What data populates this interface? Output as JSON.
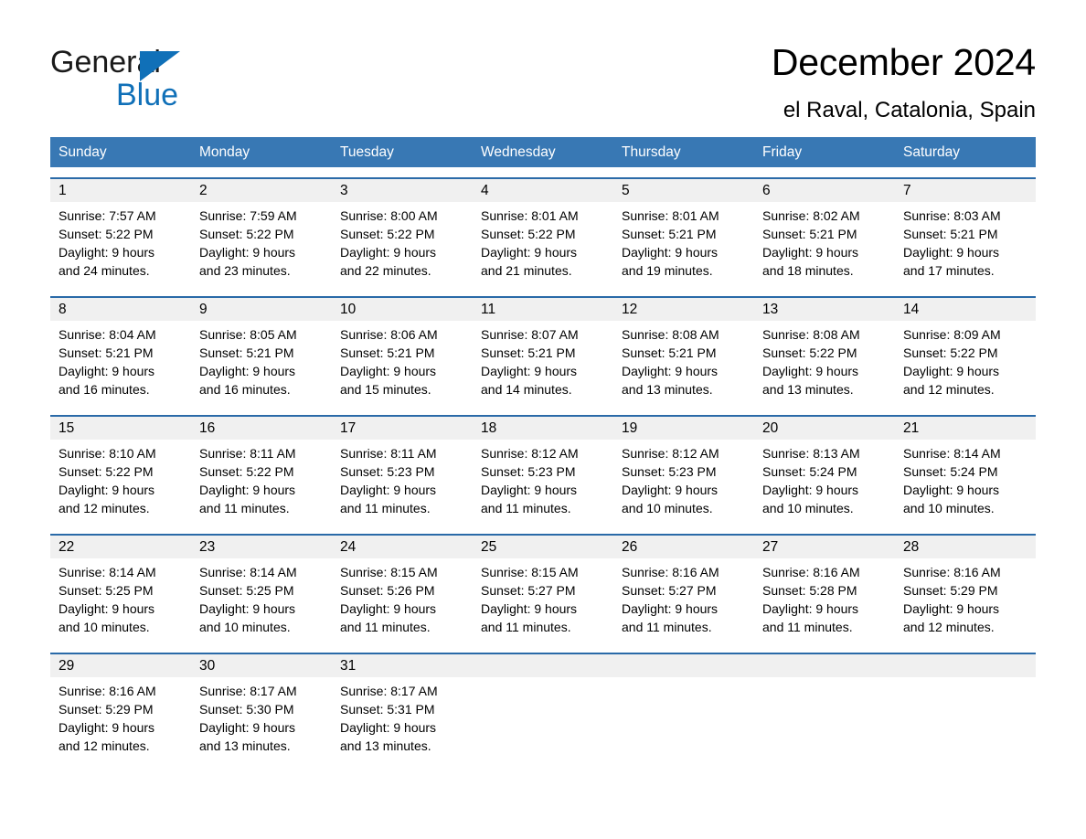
{
  "brand": {
    "name_part1": "General",
    "name_part2": "Blue",
    "triangle_color": "#1070b8"
  },
  "header": {
    "title": "December 2024",
    "subtitle": "el Raval, Catalonia, Spain"
  },
  "colors": {
    "header_blue": "#3878b4",
    "row_divider_blue": "#2a6aa8",
    "daynum_band_gray": "#f0f0f0",
    "brand_blue": "#1070b8"
  },
  "weekdays": [
    "Sunday",
    "Monday",
    "Tuesday",
    "Wednesday",
    "Thursday",
    "Friday",
    "Saturday"
  ],
  "weeks": [
    {
      "days": [
        {
          "num": "1",
          "detail": "Sunrise: 7:57 AM\nSunset: 5:22 PM\nDaylight: 9 hours\nand 24 minutes."
        },
        {
          "num": "2",
          "detail": "Sunrise: 7:59 AM\nSunset: 5:22 PM\nDaylight: 9 hours\nand 23 minutes."
        },
        {
          "num": "3",
          "detail": "Sunrise: 8:00 AM\nSunset: 5:22 PM\nDaylight: 9 hours\nand 22 minutes."
        },
        {
          "num": "4",
          "detail": "Sunrise: 8:01 AM\nSunset: 5:22 PM\nDaylight: 9 hours\nand 21 minutes."
        },
        {
          "num": "5",
          "detail": "Sunrise: 8:01 AM\nSunset: 5:21 PM\nDaylight: 9 hours\nand 19 minutes."
        },
        {
          "num": "6",
          "detail": "Sunrise: 8:02 AM\nSunset: 5:21 PM\nDaylight: 9 hours\nand 18 minutes."
        },
        {
          "num": "7",
          "detail": "Sunrise: 8:03 AM\nSunset: 5:21 PM\nDaylight: 9 hours\nand 17 minutes."
        }
      ]
    },
    {
      "days": [
        {
          "num": "8",
          "detail": "Sunrise: 8:04 AM\nSunset: 5:21 PM\nDaylight: 9 hours\nand 16 minutes."
        },
        {
          "num": "9",
          "detail": "Sunrise: 8:05 AM\nSunset: 5:21 PM\nDaylight: 9 hours\nand 16 minutes."
        },
        {
          "num": "10",
          "detail": "Sunrise: 8:06 AM\nSunset: 5:21 PM\nDaylight: 9 hours\nand 15 minutes."
        },
        {
          "num": "11",
          "detail": "Sunrise: 8:07 AM\nSunset: 5:21 PM\nDaylight: 9 hours\nand 14 minutes."
        },
        {
          "num": "12",
          "detail": "Sunrise: 8:08 AM\nSunset: 5:21 PM\nDaylight: 9 hours\nand 13 minutes."
        },
        {
          "num": "13",
          "detail": "Sunrise: 8:08 AM\nSunset: 5:22 PM\nDaylight: 9 hours\nand 13 minutes."
        },
        {
          "num": "14",
          "detail": "Sunrise: 8:09 AM\nSunset: 5:22 PM\nDaylight: 9 hours\nand 12 minutes."
        }
      ]
    },
    {
      "days": [
        {
          "num": "15",
          "detail": "Sunrise: 8:10 AM\nSunset: 5:22 PM\nDaylight: 9 hours\nand 12 minutes."
        },
        {
          "num": "16",
          "detail": "Sunrise: 8:11 AM\nSunset: 5:22 PM\nDaylight: 9 hours\nand 11 minutes."
        },
        {
          "num": "17",
          "detail": "Sunrise: 8:11 AM\nSunset: 5:23 PM\nDaylight: 9 hours\nand 11 minutes."
        },
        {
          "num": "18",
          "detail": "Sunrise: 8:12 AM\nSunset: 5:23 PM\nDaylight: 9 hours\nand 11 minutes."
        },
        {
          "num": "19",
          "detail": "Sunrise: 8:12 AM\nSunset: 5:23 PM\nDaylight: 9 hours\nand 10 minutes."
        },
        {
          "num": "20",
          "detail": "Sunrise: 8:13 AM\nSunset: 5:24 PM\nDaylight: 9 hours\nand 10 minutes."
        },
        {
          "num": "21",
          "detail": "Sunrise: 8:14 AM\nSunset: 5:24 PM\nDaylight: 9 hours\nand 10 minutes."
        }
      ]
    },
    {
      "days": [
        {
          "num": "22",
          "detail": "Sunrise: 8:14 AM\nSunset: 5:25 PM\nDaylight: 9 hours\nand 10 minutes."
        },
        {
          "num": "23",
          "detail": "Sunrise: 8:14 AM\nSunset: 5:25 PM\nDaylight: 9 hours\nand 10 minutes."
        },
        {
          "num": "24",
          "detail": "Sunrise: 8:15 AM\nSunset: 5:26 PM\nDaylight: 9 hours\nand 11 minutes."
        },
        {
          "num": "25",
          "detail": "Sunrise: 8:15 AM\nSunset: 5:27 PM\nDaylight: 9 hours\nand 11 minutes."
        },
        {
          "num": "26",
          "detail": "Sunrise: 8:16 AM\nSunset: 5:27 PM\nDaylight: 9 hours\nand 11 minutes."
        },
        {
          "num": "27",
          "detail": "Sunrise: 8:16 AM\nSunset: 5:28 PM\nDaylight: 9 hours\nand 11 minutes."
        },
        {
          "num": "28",
          "detail": "Sunrise: 8:16 AM\nSunset: 5:29 PM\nDaylight: 9 hours\nand 12 minutes."
        }
      ]
    },
    {
      "days": [
        {
          "num": "29",
          "detail": "Sunrise: 8:16 AM\nSunset: 5:29 PM\nDaylight: 9 hours\nand 12 minutes."
        },
        {
          "num": "30",
          "detail": "Sunrise: 8:17 AM\nSunset: 5:30 PM\nDaylight: 9 hours\nand 13 minutes."
        },
        {
          "num": "31",
          "detail": "Sunrise: 8:17 AM\nSunset: 5:31 PM\nDaylight: 9 hours\nand 13 minutes."
        },
        {
          "num": "",
          "detail": ""
        },
        {
          "num": "",
          "detail": ""
        },
        {
          "num": "",
          "detail": ""
        },
        {
          "num": "",
          "detail": ""
        }
      ]
    }
  ]
}
